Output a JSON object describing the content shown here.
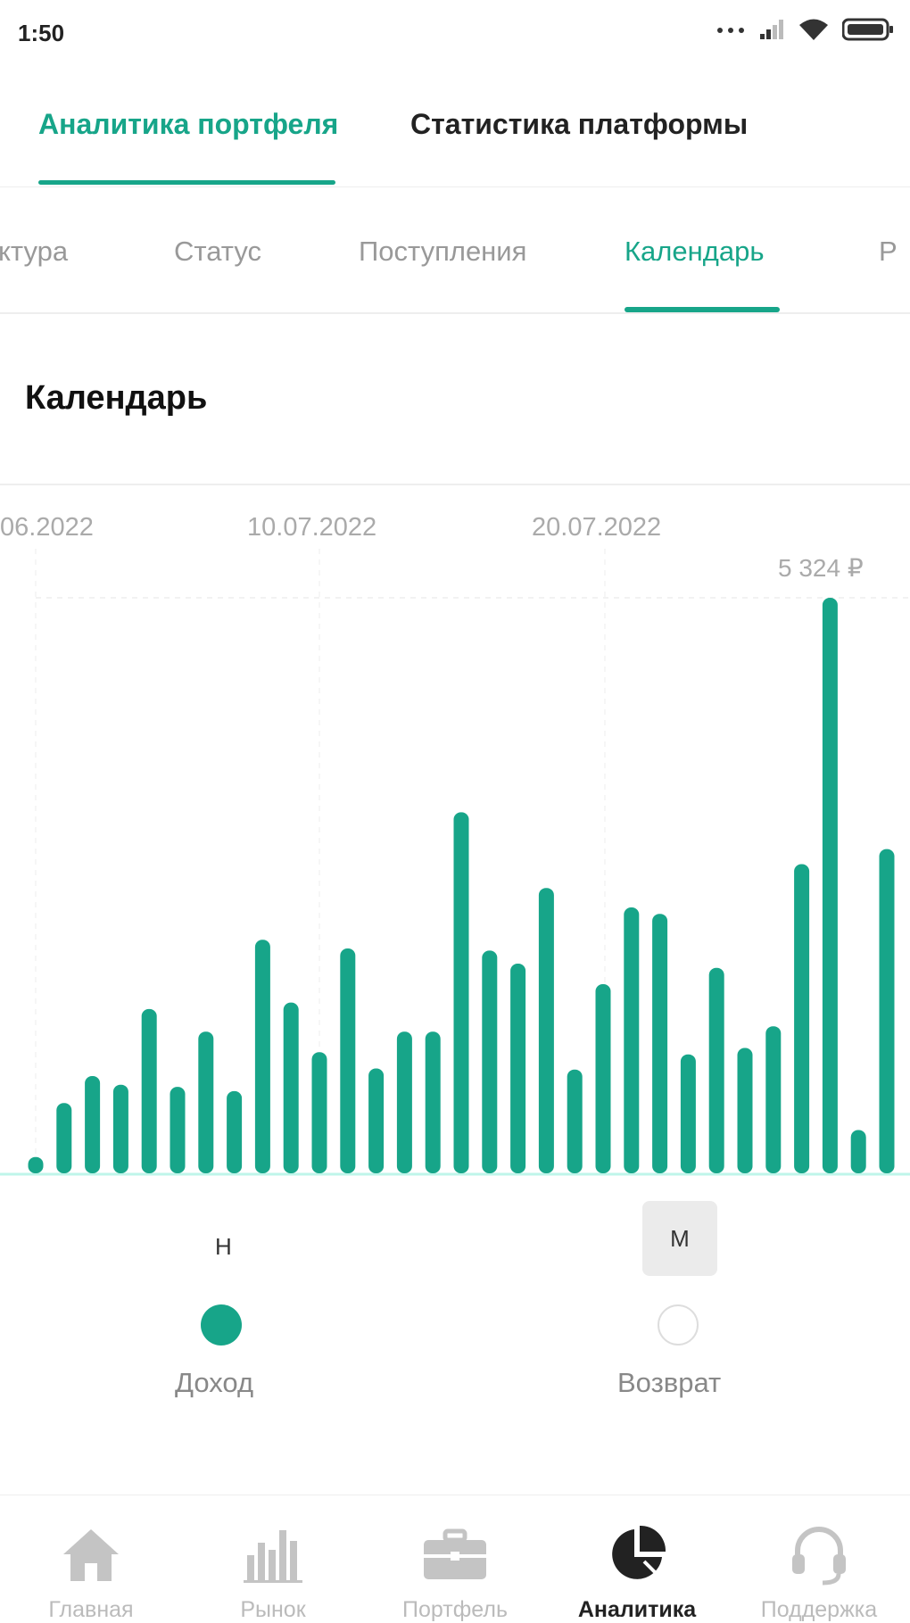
{
  "status_bar": {
    "time": "1:50"
  },
  "top_tabs": [
    {
      "label": "Аналитика портфеля",
      "active": true
    },
    {
      "label": "Статистика платформы",
      "active": false
    }
  ],
  "sub_tabs": [
    {
      "label": "ктура",
      "active": false
    },
    {
      "label": "Статус",
      "active": false
    },
    {
      "label": "Поступления",
      "active": false
    },
    {
      "label": "Календарь",
      "active": true
    },
    {
      "label": "Р",
      "active": false
    }
  ],
  "section": {
    "title": "Календарь"
  },
  "chart_data": {
    "type": "bar",
    "x_tick_labels": [
      "06.2022",
      "10.07.2022",
      "20.07.2022"
    ],
    "max_label": "5 324 ₽",
    "values": [
      150,
      650,
      900,
      820,
      1520,
      800,
      1310,
      760,
      2160,
      1580,
      1120,
      2080,
      970,
      1310,
      1310,
      3340,
      2060,
      1940,
      2640,
      960,
      1750,
      2460,
      2400,
      1100,
      1900,
      1160,
      1360,
      2860,
      5324,
      400,
      3000
    ],
    "ylim": [
      0,
      5324
    ],
    "color": "#17a589",
    "grid": true
  },
  "legend": {
    "n_label": "Н",
    "m_label": "М",
    "income_label": "Доход",
    "return_label": "Возврат",
    "income_color": "#17a589"
  },
  "bottom_nav": [
    {
      "label": "Главная",
      "icon": "home-icon",
      "active": false
    },
    {
      "label": "Рынок",
      "icon": "market-icon",
      "active": false
    },
    {
      "label": "Портфель",
      "icon": "briefcase-icon",
      "active": false
    },
    {
      "label": "Аналитика",
      "icon": "pie-chart-icon",
      "active": true
    },
    {
      "label": "Поддержка",
      "icon": "headset-icon",
      "active": false
    }
  ]
}
